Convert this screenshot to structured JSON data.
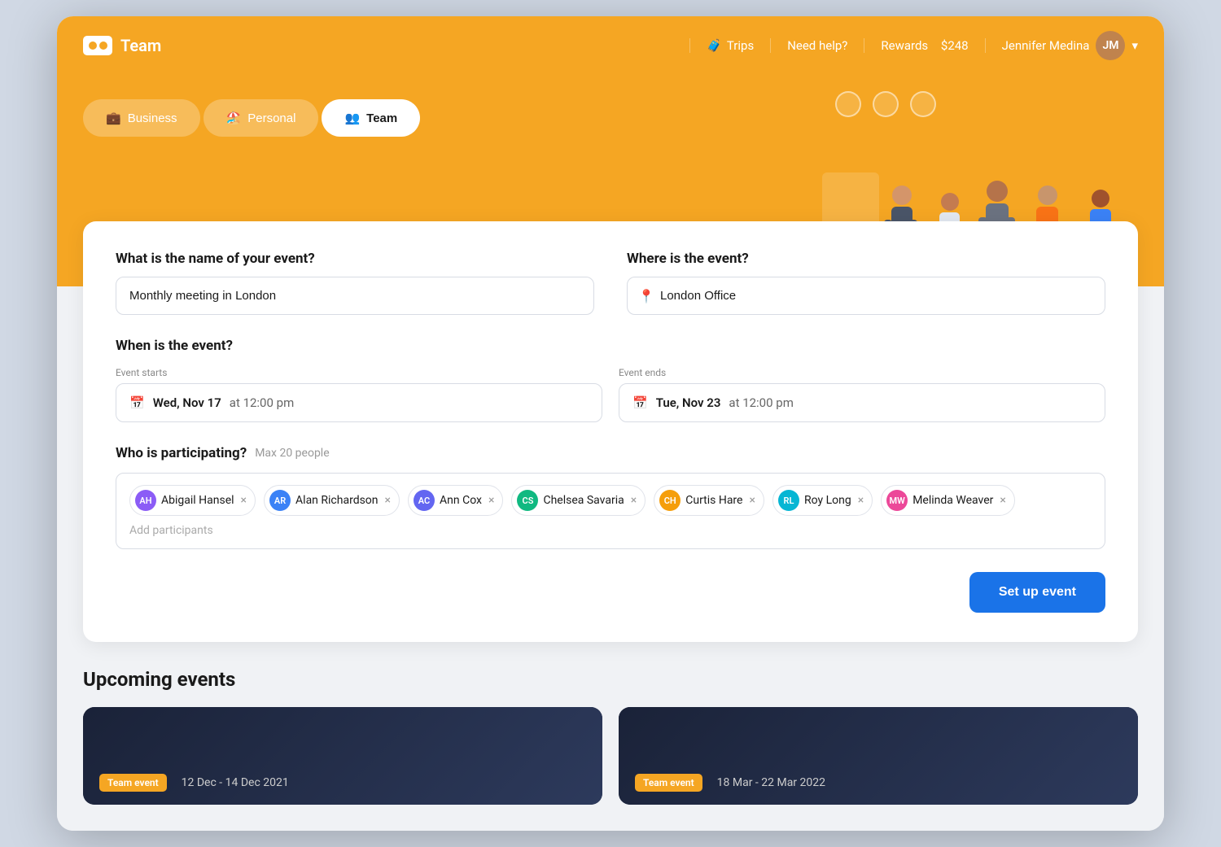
{
  "header": {
    "logo_text": "Team",
    "nav": {
      "trips": "Trips",
      "help": "Need help?",
      "rewards": "Rewards",
      "rewards_amount": "$248",
      "user_name": "Jennifer Medina"
    }
  },
  "tabs": [
    {
      "id": "business",
      "label": "Business",
      "active": false
    },
    {
      "id": "personal",
      "label": "Personal",
      "active": false
    },
    {
      "id": "team",
      "label": "Team",
      "active": true
    }
  ],
  "form": {
    "event_name_label": "What is the name of your event?",
    "event_name_value": "Monthly meeting in London",
    "event_location_label": "Where is the event?",
    "event_location_value": "London Office",
    "event_when_label": "When is the event?",
    "event_starts_sublabel": "Event starts",
    "event_starts_date": "Wed, Nov 17",
    "event_starts_time": "at 12:00 pm",
    "event_ends_sublabel": "Event ends",
    "event_ends_date": "Tue, Nov 23",
    "event_ends_time": "at 12:00 pm",
    "participants_label": "Who is participating?",
    "participants_max": "Max 20 people",
    "add_participants_placeholder": "Add participants",
    "setup_button": "Set up event"
  },
  "participants": [
    {
      "id": "abigail",
      "name": "Abigail Hansel",
      "initials": "AH",
      "color_class": "av-abigail"
    },
    {
      "id": "alan",
      "name": "Alan Richardson",
      "initials": "AR",
      "color_class": "av-alan"
    },
    {
      "id": "ann",
      "name": "Ann Cox",
      "initials": "AC",
      "color_class": "av-ann"
    },
    {
      "id": "chelsea",
      "name": "Chelsea Savaria",
      "initials": "CS",
      "color_class": "av-chelsea"
    },
    {
      "id": "curtis",
      "name": "Curtis Hare",
      "initials": "CH",
      "color_class": "av-curtis"
    },
    {
      "id": "roy",
      "name": "Roy Long",
      "initials": "RL",
      "color_class": "av-roy"
    },
    {
      "id": "melinda",
      "name": "Melinda Weaver",
      "initials": "MW",
      "color_class": "av-melinda"
    }
  ],
  "upcoming": {
    "section_title": "Upcoming events",
    "events": [
      {
        "tag": "Team event",
        "date_range": "12 Dec - 14 Dec 2021"
      },
      {
        "tag": "Team event",
        "date_range": "18 Mar - 22 Mar 2022"
      }
    ]
  }
}
